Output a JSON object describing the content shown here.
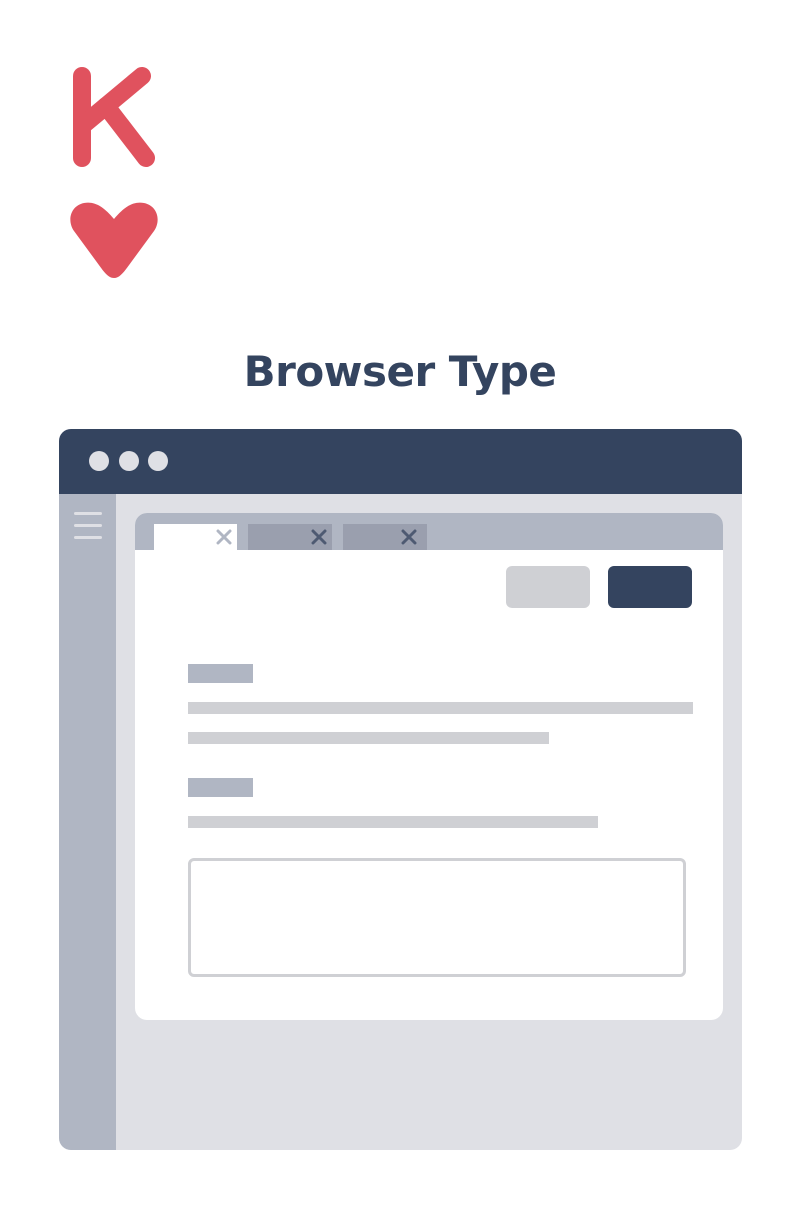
{
  "card": {
    "rank": "K",
    "suit": "heart-icon",
    "color": "#e0525e"
  },
  "title": "Browser Type",
  "colors": {
    "navy": "#34445f",
    "sidebar_gray": "#b0b6c3",
    "tab_inactive": "#9a9fae",
    "light_gray": "#cfd0d4",
    "background_gray": "#dfe0e5",
    "x_active": "#b0b6c3",
    "x_inactive": "#4e5a72"
  },
  "window": {
    "controls": [
      "window-dot-icon",
      "window-dot-icon",
      "window-dot-icon"
    ],
    "menu_icon": "hamburger-menu-icon",
    "tabs": [
      {
        "state": "active",
        "close_icon": "close-icon"
      },
      {
        "state": "inactive",
        "close_icon": "close-icon"
      },
      {
        "state": "inactive",
        "close_icon": "close-icon"
      }
    ],
    "buttons": [
      {
        "style": "secondary"
      },
      {
        "style": "primary"
      }
    ]
  }
}
